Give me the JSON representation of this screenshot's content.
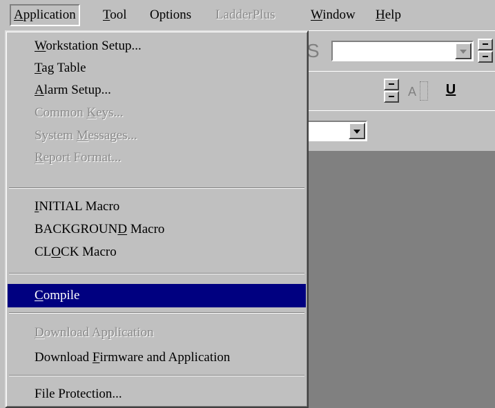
{
  "menubar": {
    "items": [
      {
        "label": "Application",
        "state": "active"
      },
      {
        "label": "Tool",
        "state": "normal"
      },
      {
        "label": "Options",
        "state": "normal"
      },
      {
        "label": "LadderPlus",
        "state": "disabled"
      },
      {
        "label": "Window",
        "state": "normal"
      },
      {
        "label": "Help",
        "state": "normal"
      }
    ]
  },
  "application_menu": {
    "items": [
      {
        "label": "Workstation Setup...",
        "enabled": true
      },
      {
        "label": "Tag Table",
        "enabled": true
      },
      {
        "label": "Alarm Setup...",
        "enabled": true
      },
      {
        "label": "Common Keys...",
        "enabled": false
      },
      {
        "label": "System Messages...",
        "enabled": false
      },
      {
        "label": "Report Format...",
        "enabled": false
      },
      {
        "label": "INITIAL Macro",
        "enabled": true
      },
      {
        "label": "BACKGROUND Macro",
        "enabled": true
      },
      {
        "label": "CLOCK Macro",
        "enabled": true
      },
      {
        "label": "Compile",
        "enabled": true,
        "selected": true
      },
      {
        "label": "Download Application",
        "enabled": false
      },
      {
        "label": "Download Firmware and Application",
        "enabled": true
      },
      {
        "label": "File Protection...",
        "enabled": true
      }
    ]
  },
  "toolbar": {
    "font_letter": "S",
    "text_align_icon": "A",
    "underline_icon": "U"
  },
  "colors": {
    "face": "#c0c0c0",
    "selection": "#000080",
    "workspace": "#808080"
  }
}
